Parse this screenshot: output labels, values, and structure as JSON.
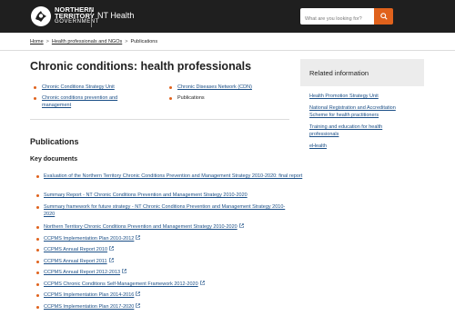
{
  "header": {
    "logo_line1": "NORTHERN",
    "logo_line2": "TERRITORY",
    "logo_line3": "GOVERNMENT",
    "site_name": "NT Health",
    "search_placeholder": "What are you looking for?",
    "search_icon": "search-icon",
    "colors": {
      "bar": "#1f1f1f",
      "accent": "#e0621c",
      "link": "#1a4e86"
    }
  },
  "breadcrumb": {
    "items": [
      "Home",
      "Health professionals and NGOs",
      "Publications"
    ],
    "separator": ">"
  },
  "page": {
    "title": "Chronic conditions: health professionals",
    "toc": [
      "Chronic Conditions Strategy Unit",
      "Chronic Diseases Network (CDN)",
      "Chronic conditions prevention and management",
      "Publications"
    ],
    "section_heading": "Publications",
    "subsection_heading": "Key documents",
    "documents": [
      "Evaluation of the Northern Territory Chronic Conditions Prevention and Management Strategy 2010-2020: final report",
      "Summary Report - NT Chronic Conditions Prevention and Management Strategy 2010-2020",
      "Summary framework for future strategy - NT Chronic Conditions Prevention and Management Strategy 2010-2020",
      "Northern Territory Chronic Conditions Prevention and Management Strategy 2010-2020",
      "CCPMS Implementation Plan 2010-2012",
      "CCPMS Annual Report 2010",
      "CCPMS Annual Report 2011",
      "CCPMS Annual Report 2012-2013",
      "CCPMS Chronic Conditions Self-Management Framework 2012-2020",
      "CCPMS Implementation Plan 2014-2016",
      "CCPMS Implementation Plan 2017-2020"
    ]
  },
  "sidebar": {
    "title": "Related information",
    "links": [
      "Health Promotion Strategy Unit",
      "National Registration and Accreditation Scheme for health practitioners",
      "Training and education for health professionals",
      "eHealth"
    ]
  }
}
